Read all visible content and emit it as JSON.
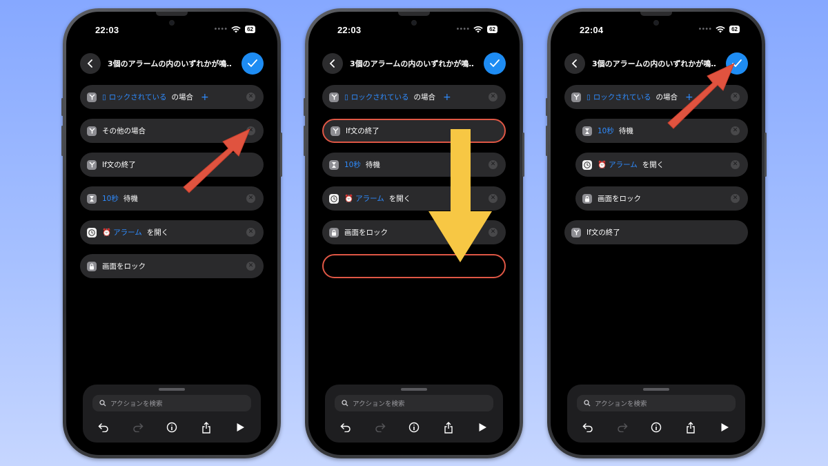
{
  "common": {
    "title": "3個のアラームの内のいずれかが鳴…",
    "search_placeholder": "アクションを検索",
    "battery": "62",
    "colors": {
      "accent": "#2f8cff",
      "confirm": "#1e8cf3",
      "highlight": "#e05745",
      "arrow_red": "#e0533f",
      "arrow_yellow": "#f7c744"
    },
    "icons": [
      "back-chevron-icon",
      "checkmark-icon",
      "search-icon",
      "undo-icon",
      "redo-icon",
      "info-icon",
      "share-icon",
      "play-icon"
    ]
  },
  "phones": [
    {
      "time": "22:03",
      "rows": [
        {
          "icon": "if-branch-icon",
          "pre": "ロックされている",
          "suffix": "の場合",
          "plus": "+"
        },
        {
          "icon": "if-branch-icon",
          "text": "その他の場合"
        },
        {
          "icon": "if-branch-icon",
          "text": "If文の終了"
        },
        {
          "icon": "hourglass-icon",
          "pre": "10秒",
          "suffix": "待機"
        },
        {
          "icon": "clock-app-icon",
          "pre": "アラーム",
          "suffix": "を開く"
        },
        {
          "icon": "lock-icon",
          "text": "画面をロック"
        }
      ]
    },
    {
      "time": "22:03",
      "rows": [
        {
          "icon": "if-branch-icon",
          "pre": "ロックされている",
          "suffix": "の場合",
          "plus": "+"
        },
        {
          "icon": "if-branch-icon",
          "text": "If文の終了"
        },
        {
          "icon": "hourglass-icon",
          "pre": "10秒",
          "suffix": "待機"
        },
        {
          "icon": "clock-app-icon",
          "pre": "アラーム",
          "suffix": "を開く"
        },
        {
          "icon": "lock-icon",
          "text": "画面をロック"
        }
      ]
    },
    {
      "time": "22:04",
      "rows": [
        {
          "icon": "if-branch-icon",
          "pre": "ロックされている",
          "suffix": "の場合",
          "plus": "+"
        },
        {
          "icon": "hourglass-icon",
          "pre": "10秒",
          "suffix": "待機"
        },
        {
          "icon": "clock-app-icon",
          "pre": "アラーム",
          "suffix": "を開く"
        },
        {
          "icon": "lock-icon",
          "text": "画面をロック"
        },
        {
          "icon": "if-branch-icon",
          "text": "If文の終了"
        }
      ]
    }
  ]
}
